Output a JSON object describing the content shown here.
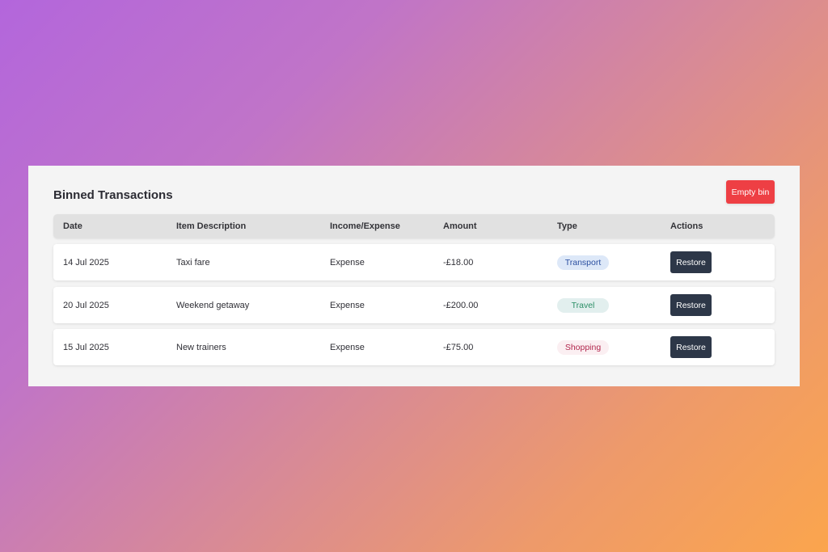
{
  "panel": {
    "title": "Binned Transactions",
    "empty_bin_label": "Empty bin"
  },
  "table": {
    "columns": [
      "Date",
      "Item Description",
      "Income/Expense",
      "Amount",
      "Type",
      "Actions"
    ],
    "rows": [
      {
        "date": "14 Jul 2025",
        "description": "Taxi fare",
        "kind": "Expense",
        "amount": "-£18.00",
        "type": "Transport",
        "action": "Restore"
      },
      {
        "date": "20 Jul 2025",
        "description": "Weekend getaway",
        "kind": "Expense",
        "amount": "-£200.00",
        "type": "Travel",
        "action": "Restore"
      },
      {
        "date": "15 Jul 2025",
        "description": "New trainers",
        "kind": "Expense",
        "amount": "-£75.00",
        "type": "Shopping",
        "action": "Restore"
      }
    ]
  },
  "colors": {
    "empty_bin_bg": "#ee3f44",
    "restore_bg": "#2d3748",
    "badge_transport_bg": "#dde8f8",
    "badge_transport_fg": "#2b4fa0",
    "badge_travel_bg": "#e2efee",
    "badge_travel_fg": "#2c8f67",
    "badge_shopping_bg": "#fbeff2",
    "badge_shopping_fg": "#b2284e"
  }
}
